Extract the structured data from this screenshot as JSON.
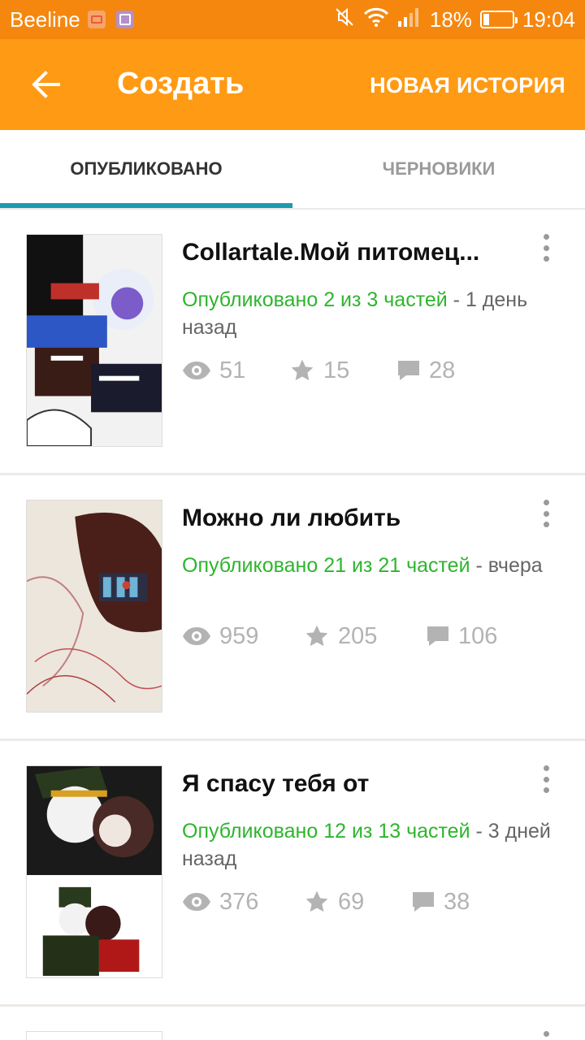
{
  "status_bar": {
    "carrier": "Beeline",
    "battery": "18%",
    "time": "19:04"
  },
  "app_bar": {
    "title": "Создать",
    "action": "НОВАЯ ИСТОРИЯ",
    "color": "#ff9a14"
  },
  "tabs": [
    {
      "label": "ОПУБЛИКОВАНО",
      "active": true
    },
    {
      "label": "ЧЕРНОВИКИ",
      "active": false
    }
  ],
  "accent_color": "#1e9aab",
  "published_color": "#2db52d",
  "stories": [
    {
      "title": "Collartale.Мой питомец...",
      "published": "Опубликовано 2 из 3 частей",
      "time": " - 1 день назад",
      "views": "51",
      "votes": "15",
      "comments": "28"
    },
    {
      "title": "Можно ли любить",
      "published": "Опубликовано 21 из 21 частей",
      "time": " - вчера",
      "views": "959",
      "votes": "205",
      "comments": "106"
    },
    {
      "title": "Я спасу тебя от",
      "published": "Опубликовано 12 из 13 частей",
      "time": " - 3 дней назад",
      "views": "376",
      "votes": "69",
      "comments": "38"
    }
  ]
}
